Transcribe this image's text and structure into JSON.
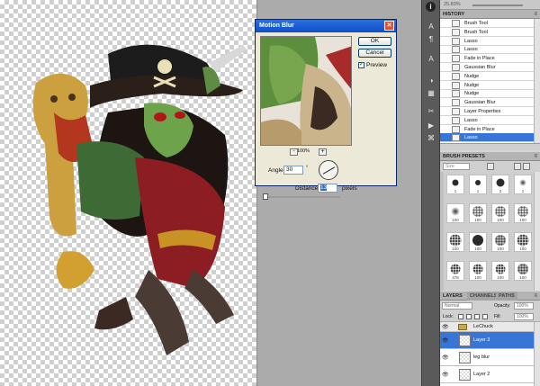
{
  "dialog": {
    "title": "Motion Blur",
    "ok_label": "OK",
    "cancel_label": "Cancel",
    "preview_label": "Preview",
    "preview_checked": true,
    "zoom_minus": "-",
    "zoom_plus": "+",
    "zoom_value": "100%",
    "angle_label": "Angle:",
    "angle_value": "30",
    "angle_unit": "°",
    "distance_label": "Distance:",
    "distance_value": "13",
    "distance_unit": "pixels"
  },
  "navigator": {
    "zoom": "25.83%"
  },
  "history": {
    "tab_label": "HISTORY",
    "items": [
      {
        "label": "Brush Tool",
        "selected": false
      },
      {
        "label": "Brush Tool",
        "selected": false
      },
      {
        "label": "Lasso",
        "selected": false
      },
      {
        "label": "Lasso",
        "selected": false
      },
      {
        "label": "Fade in Place",
        "selected": false
      },
      {
        "label": "Gaussian Blur",
        "selected": false
      },
      {
        "label": "Nudge",
        "selected": false
      },
      {
        "label": "Nudge",
        "selected": false
      },
      {
        "label": "Nudge",
        "selected": false
      },
      {
        "label": "Gaussian Blur",
        "selected": false
      },
      {
        "label": "Layer Properties",
        "selected": false
      },
      {
        "label": "Lasso",
        "selected": false
      },
      {
        "label": "Fade in Place",
        "selected": false
      },
      {
        "label": "Lasso",
        "selected": true
      }
    ]
  },
  "brushes": {
    "tab_label": "BRUSH PRESETS",
    "size_placeholder": "Size",
    "items": [
      {
        "num": "1",
        "kind": "hard",
        "d": 7
      },
      {
        "num": "1",
        "kind": "hard",
        "d": 6
      },
      {
        "num": "2",
        "kind": "hard",
        "d": 9
      },
      {
        "num": "1",
        "kind": "soft",
        "d": 8
      },
      {
        "num": "100",
        "kind": "soft",
        "d": 10
      },
      {
        "num": "100",
        "kind": "spray",
        "d": 12
      },
      {
        "num": "100",
        "kind": "spray",
        "d": 12
      },
      {
        "num": "100",
        "kind": "spray",
        "d": 12
      },
      {
        "num": "100",
        "kind": "texture",
        "d": 13
      },
      {
        "num": "100",
        "kind": "hard",
        "d": 12
      },
      {
        "num": "100",
        "kind": "texture",
        "d": 12
      },
      {
        "num": "100",
        "kind": "texture",
        "d": 13
      },
      {
        "num": "478",
        "kind": "texture",
        "d": 11
      },
      {
        "num": "100",
        "kind": "texture",
        "d": 11
      },
      {
        "num": "100",
        "kind": "texture",
        "d": 11
      },
      {
        "num": "100",
        "kind": "texture",
        "d": 12
      }
    ]
  },
  "layers": {
    "tabs": [
      "LAYERS",
      "CHANNELS",
      "PATHS"
    ],
    "blend_mode": "Normal",
    "opacity_label": "Opacity:",
    "opacity_value": "100%",
    "lock_label": "Lock:",
    "fill_label": "Fill:",
    "fill_value": "100%",
    "rows": [
      {
        "name": "LeChuck",
        "type": "group",
        "selected": false
      },
      {
        "name": "Layer 3",
        "type": "layer",
        "selected": true
      },
      {
        "name": "leg blur",
        "type": "layer",
        "selected": false
      },
      {
        "name": "Layer 2",
        "type": "layer",
        "selected": false
      }
    ]
  },
  "colors": {
    "selection": "#3875d7",
    "dialog_bg": "#ece9d8",
    "titlebar": "#0d4fc8",
    "canvas_bg": "#ababab"
  }
}
